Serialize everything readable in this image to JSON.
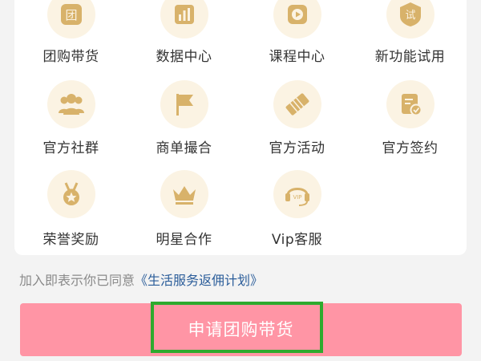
{
  "grid": {
    "items": [
      {
        "label": "团购带货",
        "icon": "group-buy-icon",
        "glyph": "团"
      },
      {
        "label": "数据中心",
        "icon": "bar-chart-icon"
      },
      {
        "label": "课程中心",
        "icon": "play-video-icon"
      },
      {
        "label": "新功能试用",
        "icon": "trial-shield-icon",
        "glyph": "试"
      },
      {
        "label": "官方社群",
        "icon": "community-users-icon"
      },
      {
        "label": "商单撮合",
        "icon": "flag-icon"
      },
      {
        "label": "官方活动",
        "icon": "ticket-icon"
      },
      {
        "label": "官方签约",
        "icon": "contract-check-icon"
      },
      {
        "label": "荣誉奖励",
        "icon": "medal-icon"
      },
      {
        "label": "明星合作",
        "icon": "crown-icon"
      },
      {
        "label": "Vip客服",
        "icon": "vip-headset-icon",
        "glyph": "VIP"
      }
    ]
  },
  "agreement": {
    "prefix": "加入即表示你已同意",
    "link": "《生活服务返佣计划》"
  },
  "apply_button": {
    "label": "申请团购带货"
  },
  "colors": {
    "icon_bg": "#fbf3e3",
    "icon_fg": "#d8b26a",
    "button_bg": "#ff95a5",
    "highlight": "#2eaa2e",
    "link": "#2b5d9a"
  }
}
